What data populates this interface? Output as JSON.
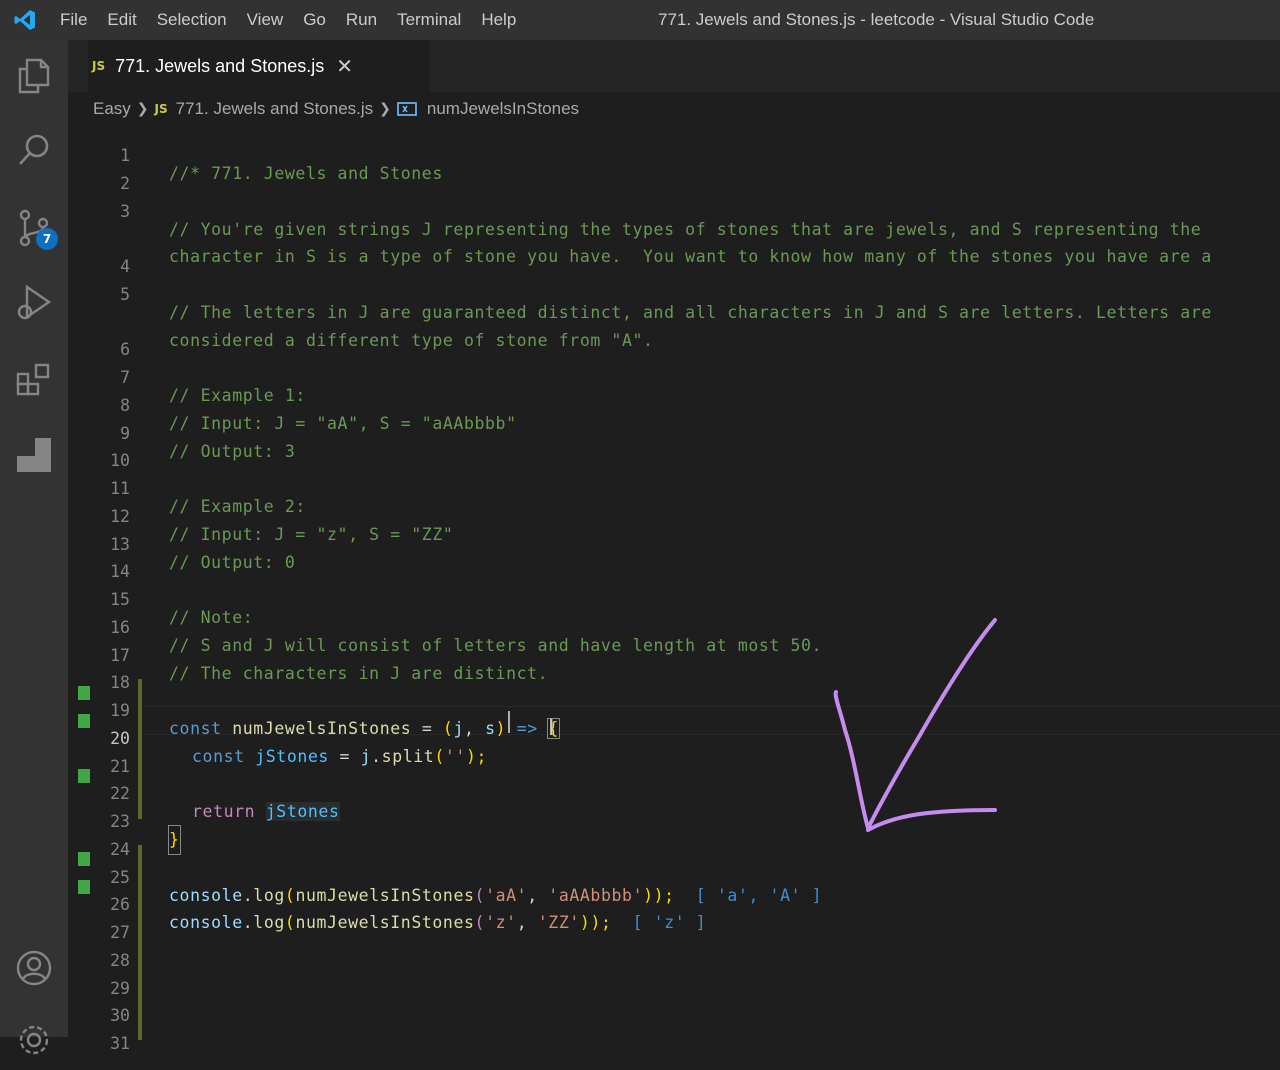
{
  "window": {
    "title": "771. Jewels and Stones.js - leetcode - Visual Studio Code"
  },
  "menu": [
    "File",
    "Edit",
    "Selection",
    "View",
    "Go",
    "Run",
    "Terminal",
    "Help"
  ],
  "activity_bar": {
    "items": [
      "explorer-icon",
      "search-icon",
      "source-control-icon",
      "run-debug-icon",
      "extensions-icon",
      "panel-icon",
      "account-icon",
      "settings-icon"
    ],
    "source_control_badge": "7"
  },
  "tab": {
    "badge": "JS",
    "label": "771. Jewels and Stones.js",
    "close": "✕"
  },
  "breadcrumb": {
    "folder": "Easy",
    "file_badge": "JS",
    "file": "771. Jewels and Stones.js",
    "symbol": "numJewelsInStones"
  },
  "editor": {
    "line_numbers": [
      "1",
      "2",
      "3",
      "",
      "4",
      "5",
      "",
      "6",
      "7",
      "8",
      "9",
      "10",
      "11",
      "12",
      "13",
      "14",
      "15",
      "16",
      "17",
      "18",
      "19",
      "20",
      "21",
      "22",
      "23",
      "24",
      "25",
      "26",
      "27",
      "28",
      "29",
      "30",
      "31"
    ],
    "lines": {
      "l1": "//* 771. Jewels and Stones",
      "l3a": "// You're given strings J representing the types of stones that are jewels, and S representing the",
      "l3b": "character in S is a type of stone you have.  You want to know how many of the stones you have are a",
      "l5a": "// The letters in J are guaranteed distinct, and all characters in J and S are letters. Letters are",
      "l5b": "considered a different type of stone from \"A\".",
      "l7": "// Example 1:",
      "l8": "// Input: J = \"aA\", S = \"aAAbbbb\"",
      "l9": "// Output: 3",
      "l11": "// Example 2:",
      "l12": "// Input: J = \"z\", S = \"ZZ\"",
      "l13": "// Output: 0",
      "l15": "// Note:",
      "l16": "// S and J will consist of letters and have length at most 50.",
      "l17": "// The characters in J are distinct."
    },
    "code": {
      "l19": {
        "kw": "const",
        "name": "numJewelsInStones",
        "eq": " = ",
        "open": "(",
        "p1": "j",
        "comma": ", ",
        "p2": "s",
        "close": ")",
        "arrow": " => ",
        "brace": "{"
      },
      "l20": {
        "kw": "const",
        "name": "jStones",
        "eq": " = ",
        "obj": "j",
        "dot": ".",
        "fn": "split",
        "open": "(",
        "str": "''",
        "close": ");"
      },
      "l22": {
        "kw": "return",
        "name": "jStones"
      },
      "l23": {
        "brace": "}"
      },
      "l25": {
        "obj": "console",
        "dot": ".",
        "fn": "log",
        "open": "(",
        "call": "numJewelsInStones",
        "open2": "(",
        "a1": "'aA'",
        "comma": ", ",
        "a2": "'aAAbbbb'",
        "close": "));",
        "result": "[ 'a', 'A' ]"
      },
      "l26": {
        "obj": "console",
        "dot": ".",
        "fn": "log",
        "open": "(",
        "call": "numJewelsInStones",
        "open2": "(",
        "a1": "'z'",
        "comma": ", ",
        "a2": "'ZZ'",
        "close": "));",
        "result": "[ 'z' ]"
      }
    }
  },
  "colors": {
    "titlebar": "#323233",
    "activitybar": "#333333",
    "editor_bg": "#1e1e1e",
    "comment": "#6a9955",
    "keyword": "#569cd6",
    "string": "#ce9178",
    "gutter_added": "#3fa845",
    "annotation_stroke": "#c58cf0"
  }
}
